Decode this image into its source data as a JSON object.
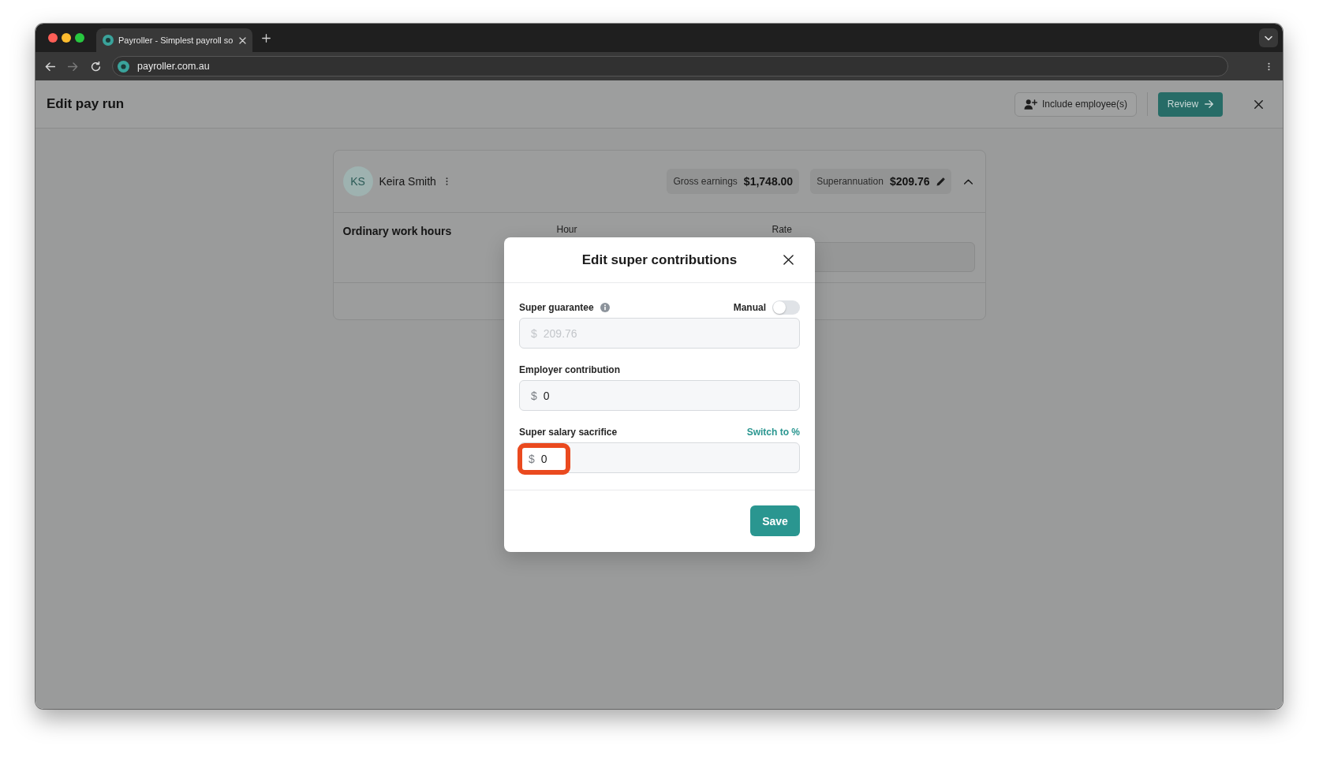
{
  "browser": {
    "tabs": [
      {
        "title": "Payroller - Simplest payroll so",
        "selected": true
      }
    ],
    "nav_buttons": [
      {
        "kind": "back",
        "disabled": false
      },
      {
        "kind": "forward",
        "disabled": true
      },
      {
        "kind": "reload",
        "disabled": false
      }
    ],
    "address": "payroller.com.au"
  },
  "header": {
    "title": "Edit pay run",
    "include_button": {
      "label": "Include employee(s)"
    },
    "review_button": {
      "label": "Review"
    }
  },
  "employee": {
    "initials": "KS",
    "name": "Keira Smith",
    "summary": [
      {
        "label": "Gross earnings",
        "value": "$1,748.00",
        "editable": false
      },
      {
        "label": "Superannuation",
        "value": "$209.76",
        "editable": true
      }
    ],
    "expanded": true,
    "section": {
      "title": "Ordinary work hours",
      "columns": [
        "Hour",
        "Rate"
      ]
    }
  },
  "modal": {
    "title": "Edit super contributions",
    "fields": [
      {
        "label": "Super guarantee",
        "info": true,
        "toggle": {
          "label": "Manual",
          "on": false
        },
        "prefix": "$",
        "value": "209.76",
        "disabled": true,
        "highlighted": false
      },
      {
        "label": "Employer contribution",
        "info": false,
        "prefix": "$",
        "value": "0",
        "disabled": false,
        "highlighted": false
      },
      {
        "label": "Super salary sacrifice",
        "info": false,
        "link": "Switch to %",
        "prefix": "$",
        "value": "0",
        "disabled": false,
        "highlighted": true
      }
    ],
    "save_button": {
      "label": "Save"
    }
  }
}
